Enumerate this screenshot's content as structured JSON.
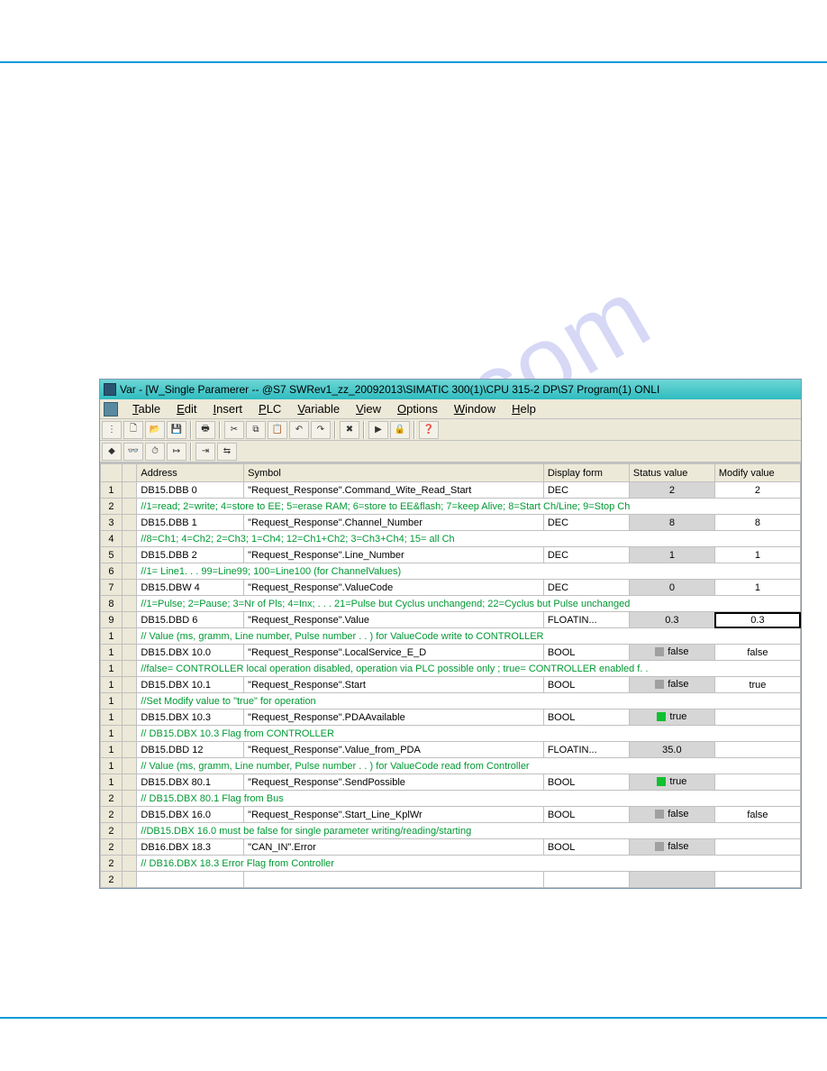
{
  "window": {
    "title": "Var - [W_Single Paramerer -- @S7 SWRev1_zz_20092013\\SIMATIC 300(1)\\CPU 315-2 DP\\S7 Program(1)  ONLI"
  },
  "menu": {
    "items": [
      "Table",
      "Edit",
      "Insert",
      "PLC",
      "Variable",
      "View",
      "Options",
      "Window",
      "Help"
    ],
    "underline": [
      0,
      0,
      0,
      0,
      0,
      0,
      0,
      0,
      0
    ]
  },
  "toolbar": {
    "row1": [
      {
        "name": "grip",
        "glyph": "⋮"
      },
      {
        "name": "new",
        "glyph": "🗋"
      },
      {
        "name": "open",
        "glyph": "📂"
      },
      {
        "name": "save",
        "glyph": "💾"
      },
      {
        "name": "sep"
      },
      {
        "name": "print",
        "glyph": "🖶"
      },
      {
        "name": "sep"
      },
      {
        "name": "cut",
        "glyph": "✂"
      },
      {
        "name": "copy",
        "glyph": "⧉"
      },
      {
        "name": "paste",
        "glyph": "📋"
      },
      {
        "name": "undo",
        "glyph": "↶"
      },
      {
        "name": "redo",
        "glyph": "↷"
      },
      {
        "name": "sep"
      },
      {
        "name": "delete",
        "glyph": "✖"
      },
      {
        "name": "sep"
      },
      {
        "name": "go",
        "glyph": "▶"
      },
      {
        "name": "lock",
        "glyph": "🔒"
      },
      {
        "name": "sep"
      },
      {
        "name": "help",
        "glyph": "❓"
      }
    ],
    "row2": [
      {
        "name": "online",
        "glyph": "◆"
      },
      {
        "name": "glasses",
        "glyph": "👓"
      },
      {
        "name": "monitor",
        "glyph": "⏱"
      },
      {
        "name": "step",
        "glyph": "↦"
      },
      {
        "name": "sep"
      },
      {
        "name": "modify",
        "glyph": "⇥"
      },
      {
        "name": "transfer",
        "glyph": "⇆"
      }
    ]
  },
  "columns": [
    "Address",
    "Symbol",
    "Display form",
    "Status value",
    "Modify value"
  ],
  "rows": [
    {
      "n": "1",
      "addr": "DB15.DBB    0",
      "sym": "\"Request_Response\".Command_Wite_Read_Start",
      "disp": "DEC",
      "status": "2",
      "modify": "2"
    },
    {
      "n": "2",
      "comment": "//1=read; 2=write; 4=store to EE; 5=erase RAM; 6=store to EE&flash; 7=keep Alive; 8=Start Ch/Line; 9=Stop Ch"
    },
    {
      "n": "3",
      "addr": "DB15.DBB    1",
      "sym": "\"Request_Response\".Channel_Number",
      "disp": "DEC",
      "status": "8",
      "modify": "8"
    },
    {
      "n": "4",
      "comment": "//8=Ch1; 4=Ch2; 2=Ch3; 1=Ch4; 12=Ch1+Ch2; 3=Ch3+Ch4; 15= all Ch"
    },
    {
      "n": "5",
      "addr": "DB15.DBB    2",
      "sym": "\"Request_Response\".Line_Number",
      "disp": "DEC",
      "status": "1",
      "modify": "1"
    },
    {
      "n": "6",
      "comment": "//1= Line1. . . 99=Line99; 100=Line100 (for ChannelValues)"
    },
    {
      "n": "7",
      "addr": "DB15.DBW    4",
      "sym": "\"Request_Response\".ValueCode",
      "disp": "DEC",
      "status": "0",
      "modify": "1"
    },
    {
      "n": "8",
      "comment": "//1=Pulse; 2=Pause; 3=Nr of Pls; 4=Inx; . . .  21=Pulse but Cyclus unchangend; 22=Cyclus but Pulse unchanged"
    },
    {
      "n": "9",
      "addr": "DB15.DBD    6",
      "sym": "\"Request_Response\".Value",
      "disp": "FLOATIN...",
      "status": "0.3",
      "modify": "0.3",
      "editing": true
    },
    {
      "n": "1",
      "comment": "// Value (ms, gramm, Line number, Pulse number . . ) for ValueCode write to CONTROLLER"
    },
    {
      "n": "1",
      "addr": "DB15.DBX   10.0",
      "sym": "\"Request_Response\".LocalService_E_D",
      "disp": "BOOL",
      "status": "false",
      "modify": "false",
      "bool": true,
      "bval": false
    },
    {
      "n": "1",
      "comment": "//false= CONTROLLER local operation disabled, operation via PLC possible only ; true= CONTROLLER enabled f. ."
    },
    {
      "n": "1",
      "addr": "DB15.DBX   10.1",
      "sym": "\"Request_Response\".Start",
      "disp": "BOOL",
      "status": "false",
      "modify": "true",
      "bool": true,
      "bval": false
    },
    {
      "n": "1",
      "comment": "//Set Modify value to \"true\" for operation"
    },
    {
      "n": "1",
      "addr": "DB15.DBX   10.3",
      "sym": "\"Request_Response\".PDAAvailable",
      "disp": "BOOL",
      "status": "true",
      "modify": "",
      "bool": true,
      "bval": true
    },
    {
      "n": "1",
      "comment": "// DB15.DBX   10.3 Flag from CONTROLLER"
    },
    {
      "n": "1",
      "addr": "DB15.DBD   12",
      "sym": "\"Request_Response\".Value_from_PDA",
      "disp": "FLOATIN...",
      "status": "35.0",
      "modify": ""
    },
    {
      "n": "1",
      "comment": "// Value (ms, gramm, Line number, Pulse number . . ) for ValueCode read from Controller"
    },
    {
      "n": "1",
      "addr": "DB15.DBX   80.1",
      "sym": "\"Request_Response\".SendPossible",
      "disp": "BOOL",
      "status": "true",
      "modify": "",
      "bool": true,
      "bval": true
    },
    {
      "n": "2",
      "comment": "// DB15.DBX   80.1 Flag from Bus"
    },
    {
      "n": "2",
      "addr": "DB15.DBX   16.0",
      "sym": "\"Request_Response\".Start_Line_KplWr",
      "disp": "BOOL",
      "status": "false",
      "modify": "false",
      "bool": true,
      "bval": false
    },
    {
      "n": "2",
      "comment": "//DB15.DBX 16.0 must be false for single parameter writing/reading/starting"
    },
    {
      "n": "2",
      "addr": "DB16.DBX   18.3",
      "sym": "\"CAN_IN\".Error",
      "disp": "BOOL",
      "status": "false",
      "modify": "",
      "bool": true,
      "bval": false
    },
    {
      "n": "2",
      "comment": "// DB16.DBX 18.3 Error Flag from Controller"
    },
    {
      "n": "2",
      "addr": "",
      "sym": "",
      "disp": "",
      "status": "",
      "modify": ""
    }
  ]
}
